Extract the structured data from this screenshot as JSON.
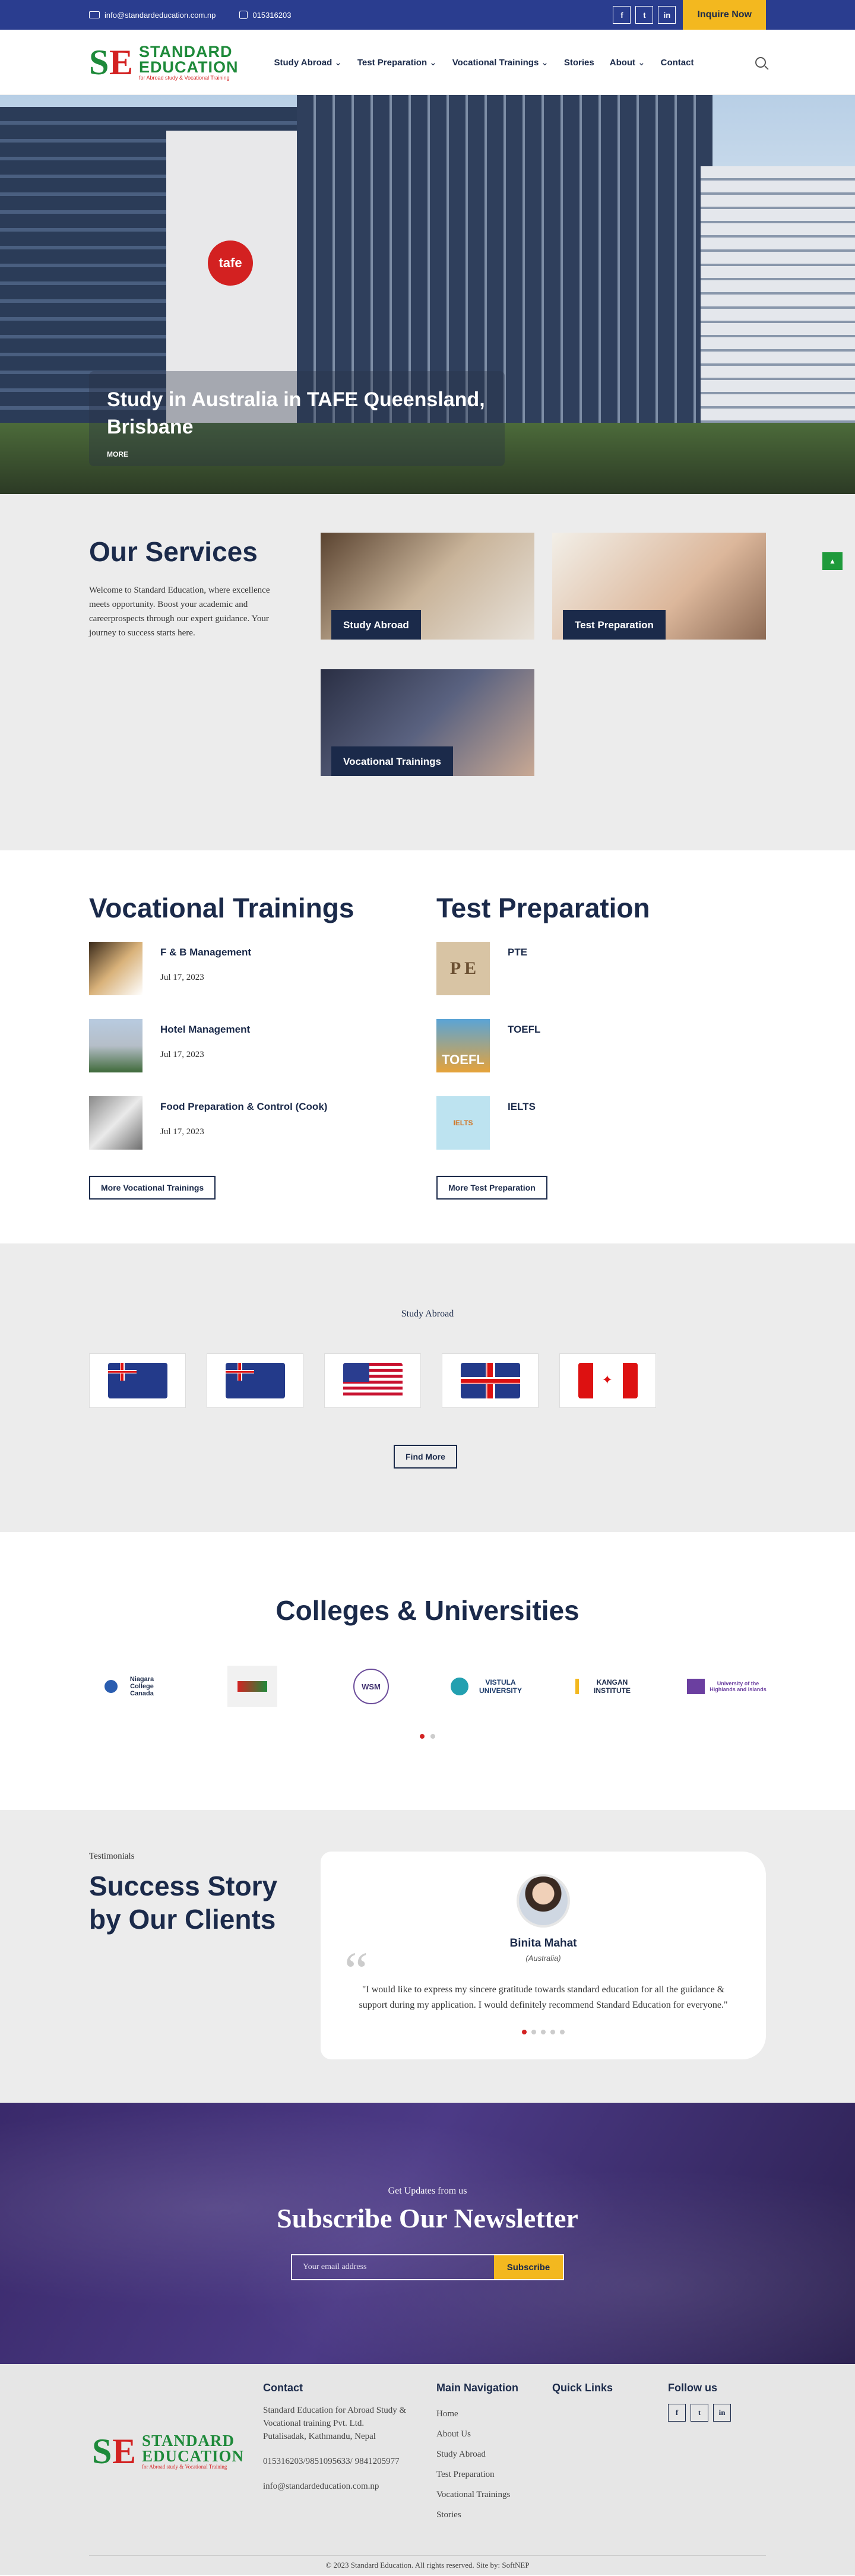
{
  "topbar": {
    "email": "info@standardeducation.com.np",
    "phone": "015316203",
    "social_icons": [
      "facebook-icon",
      "twitter-icon",
      "linkedin-icon"
    ],
    "social_glyphs": [
      "f",
      "t",
      "in"
    ],
    "inquire_label": "Inquire Now"
  },
  "brand": {
    "line1": "STANDARD",
    "line2": "EDUCATION",
    "tagline": "for Abroad study & Vocational Training"
  },
  "nav": {
    "items": [
      {
        "label": "Study Abroad"
      },
      {
        "label": "Test Preparation"
      },
      {
        "label": "Vocational Trainings"
      },
      {
        "label": "Stories"
      },
      {
        "label": "About"
      },
      {
        "label": "Contact"
      }
    ]
  },
  "hero": {
    "sign": "tafe",
    "title": "Study in Australia in TAFE Queensland, Brisbane",
    "more_label": "MORE"
  },
  "services": {
    "title": "Our Services",
    "description": "Welcome to Standard Education, where excellence meets opportunity. Boost your academic and careerprospects through our expert guidance. Your journey to success starts here.",
    "cards": [
      {
        "label": "Study Abroad"
      },
      {
        "label": "Test Preparation"
      },
      {
        "label": "Vocational Trainings"
      }
    ]
  },
  "vocational": {
    "title": "Vocational Trainings",
    "items": [
      {
        "title": "F & B Management",
        "date": "Jul 17, 2023"
      },
      {
        "title": "Hotel Management",
        "date": "Jul 17, 2023"
      },
      {
        "title": "Food Preparation & Control (Cook)",
        "date": "Jul 17, 2023"
      }
    ],
    "more_label": "More Vocational Trainings"
  },
  "testprep": {
    "title": "Test Preparation",
    "items": [
      {
        "title": "PTE",
        "thumb_text": "P E"
      },
      {
        "title": "TOEFL",
        "thumb_text": "TOEFL"
      },
      {
        "title": "IELTS",
        "thumb_text": "IELTS"
      }
    ],
    "more_label": "More Test Preparation"
  },
  "abroad": {
    "subtitle": "Study Abroad",
    "flags": [
      "australia-flag",
      "new-zealand-flag",
      "usa-flag",
      "uk-flag",
      "canada-flag"
    ],
    "find_more_label": "Find More"
  },
  "colleges": {
    "title": "Colleges & Universities",
    "logos": [
      {
        "name": "Niagara College Canada"
      },
      {
        "name": ""
      },
      {
        "name": "WSM"
      },
      {
        "name": "VISTULA UNIVERSITY"
      },
      {
        "name": "KANGAN INSTITUTE"
      },
      {
        "name": "University of the Highlands and Islands"
      }
    ]
  },
  "testimonials": {
    "tag": "Testimonials",
    "title": "Success Story by Our Clients",
    "name": "Binita Mahat",
    "country": "(Australia)",
    "quote": "\"I would like to express my sincere gratitude towards standard education for all the guidance & support during my application. I would definitely recommend Standard Education for everyone.\""
  },
  "newsletter": {
    "subtitle": "Get Updates from us",
    "title": "Subscribe Our Newsletter",
    "placeholder": "Your email address",
    "button_label": "Subscribe"
  },
  "footer": {
    "contact_title": "Contact",
    "company": "Standard Education for Abroad Study & Vocational training Pvt. Ltd.",
    "address": "Putalisadak, Kathmandu, Nepal",
    "phones": "015316203/9851095633/ 9841205977",
    "email": "info@standardeducation.com.np",
    "main_nav_title": "Main Navigation",
    "main_nav": [
      "Home",
      "About Us",
      "Study Abroad",
      "Test Preparation",
      "Vocational Trainings",
      "Stories"
    ],
    "quick_links_title": "Quick Links",
    "follow_title": "Follow us",
    "copyright": "© 2023 Standard Education. All rights reserved. Site by: SoftNEP"
  },
  "colors": {
    "primary": "#1b2a4a",
    "topbar": "#2a3d8f",
    "accent": "#f3b81f",
    "brand_green": "#1e8a3a",
    "brand_red": "#d32222"
  }
}
